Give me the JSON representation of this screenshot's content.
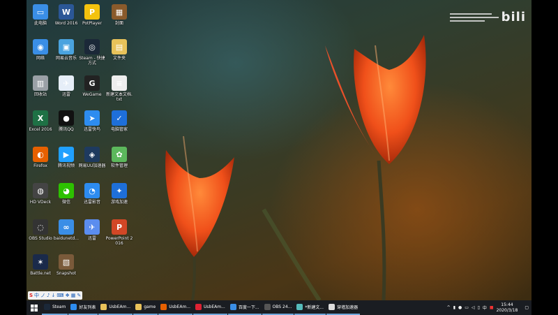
{
  "desktop": {
    "icons": [
      {
        "label": "此电脑",
        "color": "#3a8ee6",
        "glyph": "▭"
      },
      {
        "label": "Word 2016",
        "color": "#2b5797",
        "glyph": "W"
      },
      {
        "label": "PotPlayer",
        "color": "#f4c20d",
        "glyph": "P"
      },
      {
        "label": "封面",
        "color": "#8a5a2b",
        "glyph": "▦"
      },
      {
        "label": "网络",
        "color": "#3a8ee6",
        "glyph": "◉"
      },
      {
        "label": "网易云音乐",
        "color": "#4aa3df",
        "glyph": "▣"
      },
      {
        "label": "Steam - 快捷方式",
        "color": "#1b2838",
        "glyph": "◎"
      },
      {
        "label": "文件夹",
        "color": "#e8c25a",
        "glyph": "▤"
      },
      {
        "label": "回收站",
        "color": "#9aa0a6",
        "glyph": "▥"
      },
      {
        "label": "迅雷",
        "color": "#e6eef8",
        "glyph": "✈"
      },
      {
        "label": "WeGame",
        "color": "#222",
        "glyph": "G"
      },
      {
        "label": "新建文本文档.txt",
        "color": "#eeeeee",
        "glyph": "≡"
      },
      {
        "label": "Excel 2016",
        "color": "#1e7145",
        "glyph": "X"
      },
      {
        "label": "腾讯QQ",
        "color": "#111",
        "glyph": "●"
      },
      {
        "label": "迅雷快鸟",
        "color": "#2d8cf0",
        "glyph": "➤"
      },
      {
        "label": "电脑管家",
        "color": "#1e6fd9",
        "glyph": "✓"
      },
      {
        "label": "Firefox",
        "color": "#e66000",
        "glyph": "◐"
      },
      {
        "label": "腾讯视频",
        "color": "#20a0ff",
        "glyph": "▶"
      },
      {
        "label": "网易UU加速器",
        "color": "#1e3a5f",
        "glyph": "◈"
      },
      {
        "label": "软件管理",
        "color": "#5cb85c",
        "glyph": "✿"
      },
      {
        "label": "HD VDeck",
        "color": "#444",
        "glyph": "◍"
      },
      {
        "label": "微信",
        "color": "#2dc100",
        "glyph": "◕"
      },
      {
        "label": "迅雷影音",
        "color": "#2d8cf0",
        "glyph": "◔"
      },
      {
        "label": "游戏加速",
        "color": "#1e6fd9",
        "glyph": "✦"
      },
      {
        "label": "OBS Studio",
        "color": "#333",
        "glyph": "◌"
      },
      {
        "label": "baidunetd...",
        "color": "#3a8ee6",
        "glyph": "∞"
      },
      {
        "label": "迅雷",
        "color": "#5b8def",
        "glyph": "✈"
      },
      {
        "label": "PowerPoint 2016",
        "color": "#d24726",
        "glyph": "P"
      },
      {
        "label": "Battle.net",
        "color": "#1a2a4a",
        "glyph": "✶"
      },
      {
        "label": "Snapshot",
        "color": "#7a5a3a",
        "glyph": "▧"
      }
    ]
  },
  "watermark": {
    "logo": "bili"
  },
  "ime": {
    "s": "S",
    "items": [
      "中",
      "ノ",
      "♪",
      "↓",
      "⌨",
      "❖",
      "▦",
      "✎"
    ]
  },
  "taskbar": {
    "items": [
      {
        "label": "Steam",
        "color": "#1b2838"
      },
      {
        "label": "好友列表",
        "color": "#2d8cf0"
      },
      {
        "label": "UsbEAm...",
        "color": "#e8c25a"
      },
      {
        "label": "game",
        "color": "#e8c25a"
      },
      {
        "label": "UsbEAm...",
        "color": "#e66000"
      },
      {
        "label": "UsbEAm...",
        "color": "#d23"
      },
      {
        "label": "百度一下...",
        "color": "#3a8ee6"
      },
      {
        "label": "OBS 24...",
        "color": "#555"
      },
      {
        "label": "*新建文...",
        "color": "#5bb"
      },
      {
        "label": "穿墙加速器",
        "color": "#ddd"
      }
    ],
    "tray": {
      "ime": "中",
      "time": "15:44",
      "date": "2020/3/18"
    }
  }
}
